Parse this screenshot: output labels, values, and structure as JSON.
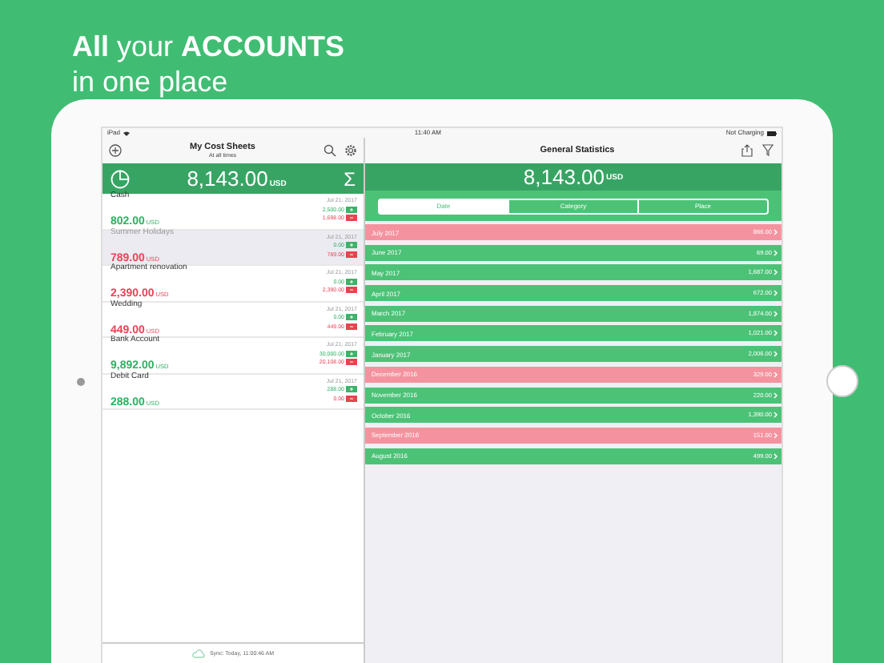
{
  "headline": {
    "line_1": "**All** your **ACCOUNTS**",
    "line_2": "in one place"
  },
  "status_bar": {
    "device": "iPad",
    "time": "11:40 AM",
    "battery": "Not Charging"
  },
  "sidebar": {
    "title": "My Cost Sheets",
    "subtitle": "At all times",
    "total": "8,143.00",
    "currency": "USD",
    "sum_symbol": "Σ",
    "accounts": [
      {
        "name": "Cash",
        "amount": "802.00",
        "currency": "USD",
        "positive": true,
        "selected": false,
        "date": "Jul 21, 2017",
        "income": "2,500.00",
        "expense": "1,698.00"
      },
      {
        "name": "Summer Holidays",
        "amount": "789.00",
        "currency": "USD",
        "positive": false,
        "selected": true,
        "date": "Jul 21, 2017",
        "income": "0.00",
        "expense": "789.00"
      },
      {
        "name": "Apartment renovation",
        "amount": "2,390.00",
        "currency": "USD",
        "positive": false,
        "selected": false,
        "date": "Jul 21, 2017",
        "income": "0.00",
        "expense": "2,390.00"
      },
      {
        "name": "Wedding",
        "amount": "449.00",
        "currency": "USD",
        "positive": false,
        "selected": false,
        "date": "Jul 21, 2017",
        "income": "0.00",
        "expense": "449.00"
      },
      {
        "name": "Bank Account",
        "amount": "9,892.00",
        "currency": "USD",
        "positive": true,
        "selected": false,
        "date": "Jul 21, 2017",
        "income": "30,000.00",
        "expense": "20,108.00"
      },
      {
        "name": "Debit Card",
        "amount": "288.00",
        "currency": "USD",
        "positive": true,
        "selected": false,
        "date": "Jul 21, 2017",
        "income": "288.00",
        "expense": "0.00"
      }
    ],
    "sync": "Sync: Today, 11:00:46 AM"
  },
  "main": {
    "title": "General Statistics",
    "total": "8,143.00",
    "currency": "USD",
    "tabs": [
      {
        "label": "Date",
        "selected": true
      },
      {
        "label": "Category",
        "selected": false
      },
      {
        "label": "Place",
        "selected": false
      }
    ],
    "months": [
      {
        "label": "July 2017",
        "amount": "866.00",
        "kind": "expense"
      },
      {
        "label": "June 2017",
        "amount": "69.00",
        "kind": "income"
      },
      {
        "label": "May 2017",
        "amount": "1,687.00",
        "kind": "income"
      },
      {
        "label": "April 2017",
        "amount": "672.00",
        "kind": "income"
      },
      {
        "label": "March 2017",
        "amount": "1,874.00",
        "kind": "income"
      },
      {
        "label": "February 2017",
        "amount": "1,021.00",
        "kind": "income"
      },
      {
        "label": "January 2017",
        "amount": "2,006.00",
        "kind": "income"
      },
      {
        "label": "December 2016",
        "amount": "329.00",
        "kind": "expense"
      },
      {
        "label": "November 2016",
        "amount": "220.00",
        "kind": "income"
      },
      {
        "label": "October 2016",
        "amount": "1,390.00",
        "kind": "income"
      },
      {
        "label": "September 2016",
        "amount": "151.00",
        "kind": "expense"
      },
      {
        "label": "August 2016",
        "amount": "499.00",
        "kind": "income"
      }
    ]
  }
}
